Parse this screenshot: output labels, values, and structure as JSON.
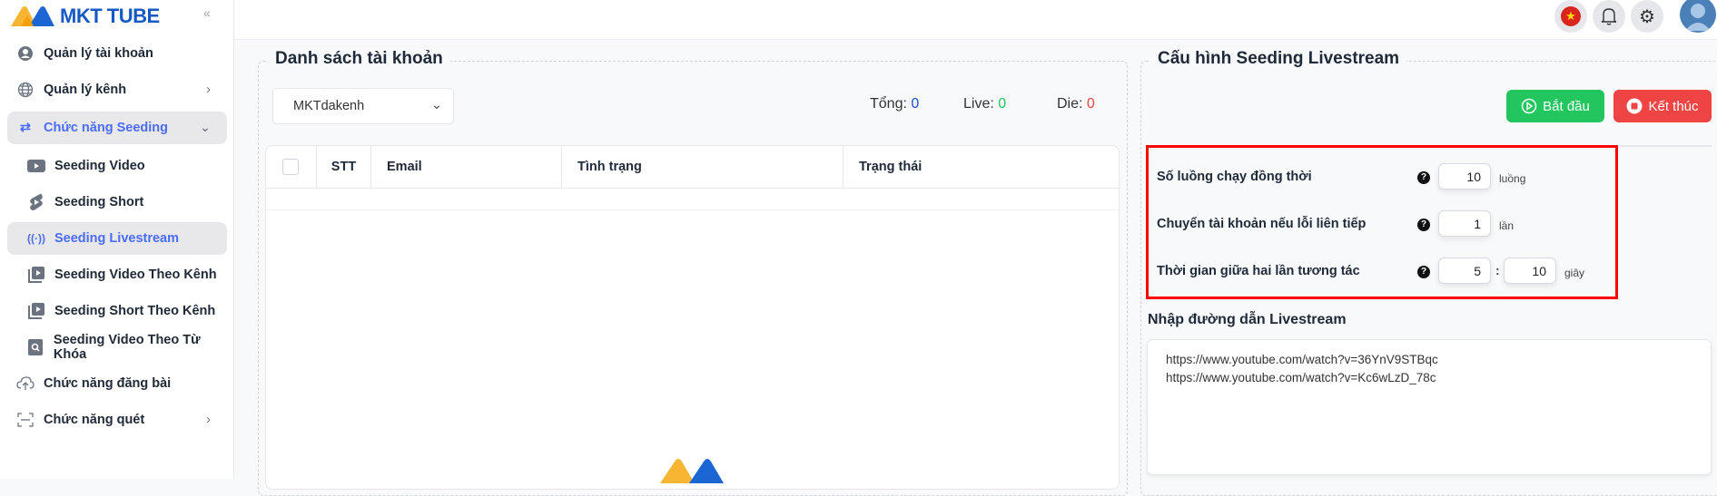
{
  "app": {
    "logo_text": "MKT TUBE",
    "collapse_icon": "double-chevron-left"
  },
  "sidebar": {
    "items": [
      {
        "label": "Quản lý tài khoản",
        "icon": "user-circle-icon"
      },
      {
        "label": "Quản lý kênh",
        "icon": "globe-icon",
        "chevron": "›"
      },
      {
        "label": "Chức năng Seeding",
        "icon": "swap-arrows-icon",
        "chevron": "⌄",
        "active": true
      },
      {
        "label": "Seeding Video",
        "icon": "video-play-icon",
        "sub": true
      },
      {
        "label": "Seeding Short",
        "icon": "shorts-icon",
        "sub": true
      },
      {
        "label": "Seeding Livestream",
        "icon": "broadcast-icon",
        "sub": true,
        "active": true
      },
      {
        "label": "Seeding Video Theo Kênh",
        "icon": "playlist-play-icon",
        "sub": true
      },
      {
        "label": "Seeding Short Theo Kênh",
        "icon": "playlist-play-icon",
        "sub": true
      },
      {
        "label": "Seeding Video Theo Từ Khóa",
        "icon": "search-file-icon",
        "sub": true
      },
      {
        "label": "Chức năng đăng bài",
        "icon": "cloud-upload-icon"
      },
      {
        "label": "Chức năng quét",
        "icon": "scan-icon",
        "chevron": "›"
      }
    ]
  },
  "topbar": {
    "language_icon": "vietnam-flag-icon",
    "bell_icon": "bell-icon",
    "settings_icon": "gear-icon",
    "avatar_icon": "user-avatar-icon"
  },
  "accounts": {
    "title": "Danh sách tài khoản",
    "select_value": "MKTdakenh",
    "stats": {
      "total_label": "Tổng:",
      "total_value": "0",
      "live_label": "Live:",
      "live_value": "0",
      "die_label": "Die:",
      "die_value": "0"
    },
    "columns": [
      "STT",
      "Email",
      "Tình trạng",
      "Trạng thái"
    ],
    "rows": []
  },
  "config": {
    "title": "Cấu hình Seeding Livestream",
    "start_label": "Bắt đầu",
    "stop_label": "Kết thúc",
    "fields": [
      {
        "label": "Số luồng chạy đồng thời",
        "value": "10",
        "unit": "luồng"
      },
      {
        "label": "Chuyển tài khoản nếu lỗi liên tiếp",
        "value": "1",
        "unit": "lần"
      },
      {
        "label": "Thời gian giữa hai lần tương tác",
        "value_min": "5",
        "separator": ":",
        "value_max": "10",
        "unit": "giây"
      }
    ],
    "help_glyph": "?",
    "links_label": "Nhập đường dẫn Livestream",
    "links": "https://www.youtube.com/watch?v=36YnV9STBqc\nhttps://www.youtube.com/watch?v=Kc6wLzD_78c"
  },
  "colors": {
    "accent": "#4a6cf7",
    "start": "#22c55e",
    "stop": "#ef4444",
    "highlight": "#ff0000",
    "total": "#1d4ed8",
    "live": "#22c55e",
    "die": "#ef4444"
  }
}
